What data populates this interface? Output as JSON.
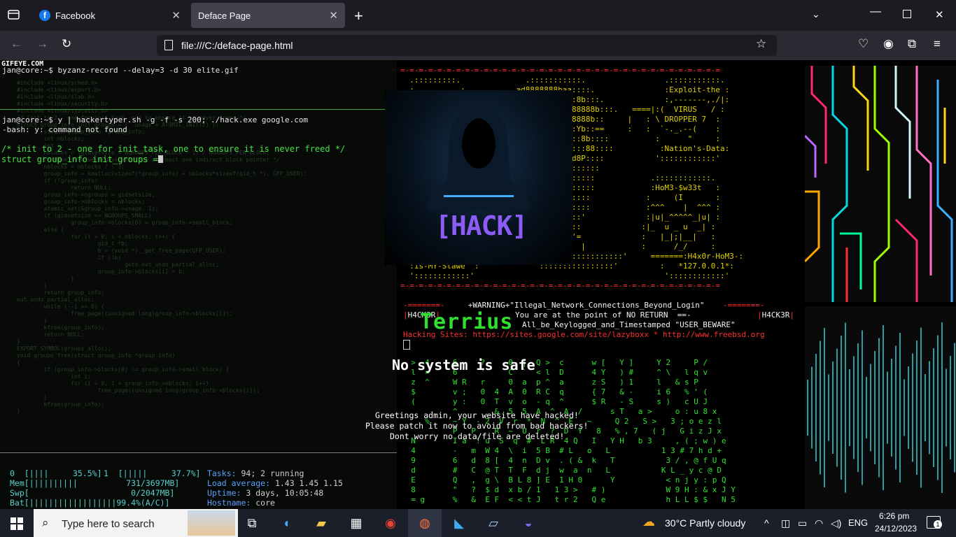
{
  "browser": {
    "tabs": [
      {
        "label": "Facebook",
        "icon": "facebook-icon"
      },
      {
        "label": "Deface Page",
        "icon": "none"
      }
    ],
    "url": "file:///C:/deface-page.html"
  },
  "terminal": {
    "watermark": "GIFEYE.COM",
    "prompt1": "jan@core:~$ byzanz-record --delay=3 -d 30 elite.gif",
    "prompt2": "jan@core:~$ y | hackertyper.sh -g -f -s 200; ./hack.exe google.com",
    "error": "-bash: y: command not found",
    "code1": "/* init to 2 - one for init_task, one to ensure it is never freed */",
    "code2": "struct group_info init_groups =",
    "faded_code": [
      "#include <linux/sched.h>",
      "#include <linux/export.h>",
      "#include <linux/slab.h>",
      "#include <linux/security.h>",
      "#include <linux/syscalls.h>",
      "/* init to 2 - one for init_task, one to ensure it is never freed */",
      "struct group_info init_groups = { .usage = ATOMIC_INIT(2) };",
      "",
      "",
      "",
      "        struct group_info *group_info;",
      "        int nblocks;",
      "        int i;",
      "",
      "        nblocks = (gidsetsize + NGROUPS_PER_BLOCK - 1) / NGROUPS_PER_BLOCK;",
      "        /* Make sure we always allocate at least one indirect block pointer */",
      "        nblocks = nblocks ? : 1;",
      "        group_info = kmalloc(sizeof(*group_info) + nblocks*sizeof(gid_t *), GFP_USER);",
      "        if (!group_info)",
      "                return NULL;",
      "        group_info->ngroups = gidsetsize;",
      "        group_info->nblocks = nblocks;",
      "        atomic_set(&group_info->usage, 1);",
      "",
      "        if (gidsetsize <= NGROUPS_SMALL)",
      "                group_info->blocks[0] = group_info->small_block;",
      "        else {",
      "                for (i = 0; i < nblocks; i++) {",
      "                        gid_t *b;",
      "                        b = (void *)__get_free_page(GFP_USER);",
      "                        if (!b)",
      "                                goto out_undo_partial_alloc;",
      "                        group_info->blocks[i] = b;",
      "                }",
      "        }",
      "        return group_info;",
      "",
      "out_undo_partial_alloc:",
      "        while (--i >= 0) {",
      "                free_page((unsigned long)group_info->blocks[i]);",
      "        }",
      "        kfree(group_info);",
      "        return NULL;",
      "}",
      "",
      "EXPORT_SYMBOL(groups_alloc);",
      "",
      "void groups_free(struct group_info *group_info)",
      "{",
      "        if (group_info->blocks[0] != group_info->small_block) {",
      "                int i;",
      "                for (i = 0; i < group_info->nblocks; i++)",
      "                        free_page((unsigned long)group_info->blocks[i]);",
      "        }",
      "        kfree(group_info);",
      "}"
    ],
    "htop": {
      "cpu0": "0  [||||     35.5%]",
      "cpu1": "1  [|||||     37.7%]",
      "mem": "Mem[||||||||||          731/3697MB]",
      "swp": "Swp[                     0/2047MB]",
      "bat": "Bat[||||||||||||||||||99.4%(A/C)]",
      "tasks_label": "Tasks: ",
      "tasks_value": "94; 2 running",
      "load_label": "Load average: ",
      "load_value": "1.43 1.45 1.15",
      "uptime_label": "Uptime: ",
      "uptime_value": "3 days, 10:05:48",
      "host_label": "Hostname: ",
      "host_value": "core"
    }
  },
  "banner": {
    "lines": [
      {
        "cls": "r",
        "text": "=-=-=-=-=-=-=-=-=-=-=-=-=-=-=-=-=-=-=-=-=-=-=-=-=-=-=-=-=-=-=-=-=-=-="
      },
      {
        "cls": "y",
        "text": "  .:::::::::.              .:::::::::::.                 .:::::::::::."
      },
      {
        "cls": "y",
        "text": "  :          :           ad8888888baa::::.               :Exploit-the :"
      },
      {
        "cls": "y",
        "text": "  :          :         d8888888888??::8b:::.             :,-------,./|:"
      },
      {
        "cls": "y",
        "text": "  :          :        d8888888888??a888888b:::.   ====|:(  VIRUS   / :"
      },
      {
        "cls": "y",
        "text": "  :          :      d88888888aa8888888888b::     |   : \\ DROPPER 7  :"
      },
      {
        "cls": "y",
        "text": "  :          :     d8888888888::::::::Yb::==     :   :  `-._.--(    :"
      },
      {
        "cls": "y",
        "text": "  :          :    .Y888888P::::::::::::8b::::          :      \"     :"
      },
      {
        "cls": "y",
        "text": "  :          :    :Y8888P::::::::@::::::88::::          :Nation's-Data:"
      },
      {
        "cls": "y",
        "text": "  :          :    88P:T:Y88aaaaaaaaaad8P::::           '::::::::::::'"
      },
      {
        "cls": "y",
        "text": "  :          :    8P::::Y8888888888P:::::::"
      },
      {
        "cls": "y",
        "text": "  :          :    ::::::888:::::::::::::::            .::::::::::::."
      },
      {
        "cls": "y",
        "text": "  :          :    8888888888888b::::::::::            :HoM3-$w33t   :"
      },
      {
        "cls": "y",
        "text": "  :          :    8888888888888::::::::::            :     (I       :"
      },
      {
        "cls": "y",
        "text": "  :          :    8888888888888::::::::::            :^^^    |  ^^^ :"
      },
      {
        "cls": "y",
        "text": "  :          :    88::::88:::::::::::::'             :|u|_^^^^^_|u| :"
      },
      {
        "cls": "y",
        "text": "  :          :    88::::88:::::::::::::             :|_  u _ u  _| :"
      },
      {
        "cls": "y",
        "text": "  :          :    88::::P::::88::::::'=             :   |_|;|__|   :"
      },
      {
        "cls": "y",
        "text": "  :          :    88::::::::88:::::'   |            :      /_/     :"
      },
      {
        "cls": "y",
        "text": "  :Ur-Computer- :=======    ::::::::::::::::::::'     =======:H4x0r-HoM3-:"
      },
      {
        "cls": "y",
        "text": "  :is-MY-Slawe  :            '::::::::::::::::'         :   *127.0.0.1*:"
      },
      {
        "cls": "y",
        "text": "  '::::::::::::'                                         '::::::::::::'"
      },
      {
        "cls": "r",
        "text": "=-=-=-=-=-=-=-=-=-=-=-=-=-=-=-=-=-=-=-=-=-=-=-=-=-=-=-=-=-=-=-=-=-=-="
      }
    ],
    "warning": "+WARNING+\"Illegal_Network_Connections_Beyond_Login\"",
    "point": "You are at the point of NO RETURN  ==-",
    "keylog": "All_be_Keylogged_and_Timestamped \"USER_BEWARE\"",
    "h4ck3r": "H4CK3R",
    "hacking_label": "Hacking Sites:",
    "hacking_sites": "https://sites.google.com/site/lazyboxx * http://www.freebsd.org",
    "hack_image_text": "[HACK]",
    "terrius": "Terrius",
    "no_system": "No system is safe",
    "greet1": "Greetings admin, your website have hacked!",
    "greet2": "Please patch it now to avoid from bad hackers!",
    "greet3": "Dont worry no data/file are deleted!"
  },
  "matrix_rows": [
    "  >  4     6     ?     0  |  Q >  c      w [   Y ]     Y 2     P /",
    "  l  =     6     '     C  `  < l  D      4 Y   ) #     ^ \\   l q v",
    "  z  ^     W R   r     0  a  p ^  a      z S   ) 1     l   & s P",
    "  $        v ;   0  4  A  0  R C  q      { 7   & -     i 6   % ' (",
    "  (        y :   0  T  v  o  - q  ^      $ R   - S     s )   c U J",
    "      -    ^        &  5  5  A  ^  A  /      s T   a >     o : u 8 x",
    "     %     ~ Y  - 2  V  r  *  N  ^  E   ~     Q 2   S >   3 ; o e z l",
    "           P   P    R  ~  U  r  ?  D  Y   8   % , 7   ( j   G i z J x",
    "  N        I a  ! u  S  q  #  L R  4 Q   I   Y H   b 3     , ( ; w ) e",
    "  4        -   m  W 4  \\  i  5 B  # L   o   L           1 3 # 7 h d +",
    "  9        6   d  8 [  4  n  D v  . ( &  k   T           3 / , @ f U q",
    "  d        #   C  @ T  T  F  d j  w  a  n   L           K L _ y c @ D",
    "  E        Q   ,  g \\  B L 8 ] E  1 H 0      Y           < n j y : p Q",
    "  8        \"   ?  $ d  x b / 1   1 3 >   # )             W 9 H : & x J Y",
    "  = g      %   &  E F  < < t J   t r 2   Q e             h L L $ $   N 5"
  ],
  "taskbar": {
    "search_placeholder": "Type here to search",
    "weather": "30°C  Partly cloudy",
    "lang": "ENG",
    "time": "6:26 pm",
    "date": "24/12/2023",
    "notif_count": "1"
  }
}
